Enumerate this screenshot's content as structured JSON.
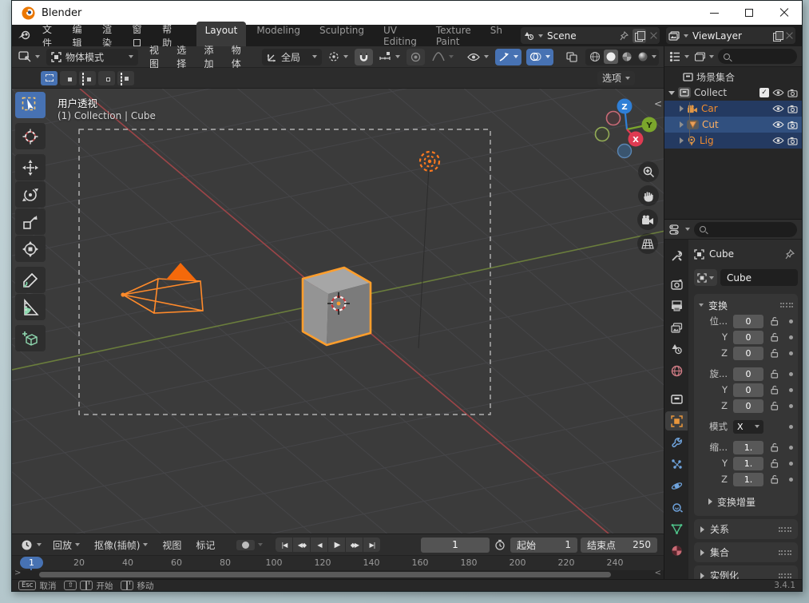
{
  "window": {
    "app_title": "Blender",
    "version": "3.4.1"
  },
  "topbar": {
    "menus": [
      "文件",
      "编辑",
      "渲染",
      "窗口",
      "帮助"
    ],
    "workspaces": [
      "Layout",
      "Modeling",
      "Sculpting",
      "UV Editing",
      "Texture Paint",
      "Sh"
    ],
    "active_workspace": "Layout",
    "scene_selector": {
      "value": "Scene"
    },
    "view_layer_selector": {
      "value": "ViewLayer"
    }
  },
  "viewport_header": {
    "mode": "物体模式",
    "menus": [
      "视图",
      "选择",
      "添加",
      "物体"
    ],
    "orientation": "全局"
  },
  "tool_settings": {
    "options_label": "选项"
  },
  "viewport": {
    "view_name": "用户透视",
    "context_breadcrumb": "(1) Collection | Cube",
    "axis_labels": {
      "x": "X",
      "y": "Y",
      "z": "Z"
    }
  },
  "outliner": {
    "scene_collection": "场景集合",
    "collection": "Collect",
    "objects": [
      {
        "name": "Car"
      },
      {
        "name": "Cut"
      },
      {
        "name": "Lig"
      }
    ]
  },
  "properties": {
    "breadcrumb": "Cube",
    "object_name": "Cube",
    "transform": {
      "title": "变换",
      "rows": [
        {
          "label": "位...",
          "value": "0"
        },
        {
          "label": "Y",
          "value": "0"
        },
        {
          "label": "Z",
          "value": "0"
        },
        {
          "label": "旋...",
          "value": "0"
        },
        {
          "label": "Y",
          "value": "0"
        },
        {
          "label": "Z",
          "value": "0"
        },
        {
          "label": "模式",
          "value": "X"
        },
        {
          "label": "缩...",
          "value": "1."
        },
        {
          "label": "Y",
          "value": "1."
        },
        {
          "label": "Z",
          "value": "1."
        }
      ],
      "subpanel": "变换增量"
    },
    "panels": [
      "关系",
      "集合",
      "实例化"
    ]
  },
  "timeline": {
    "menus": [
      "回放",
      "抠像(插帧)",
      "视图",
      "标记"
    ],
    "transport": [
      "|◀",
      "◀◆",
      "◀",
      "▶",
      "◆▶",
      "▶|"
    ],
    "current_frame": "1",
    "start_label": "起始",
    "start_value": "1",
    "end_label": "结束点",
    "end_value": "250",
    "ruler_ticks": [
      "20",
      "40",
      "60",
      "80",
      "100",
      "120",
      "140",
      "160",
      "180",
      "200",
      "220",
      "240"
    ]
  },
  "statusbar": {
    "hints": [
      {
        "key": "Esc",
        "label": "取消"
      },
      {
        "key": "⇧",
        "label": "开始"
      },
      {
        "key": "",
        "label": "移动"
      }
    ],
    "version": "3.4.1"
  },
  "colors": {
    "accent_blue": "#4772b3",
    "selection_orange": "#ff9e2c",
    "axis_x_red": "#e03b52",
    "axis_y_green": "#7ba62c",
    "axis_z_blue": "#2f7fd6"
  }
}
